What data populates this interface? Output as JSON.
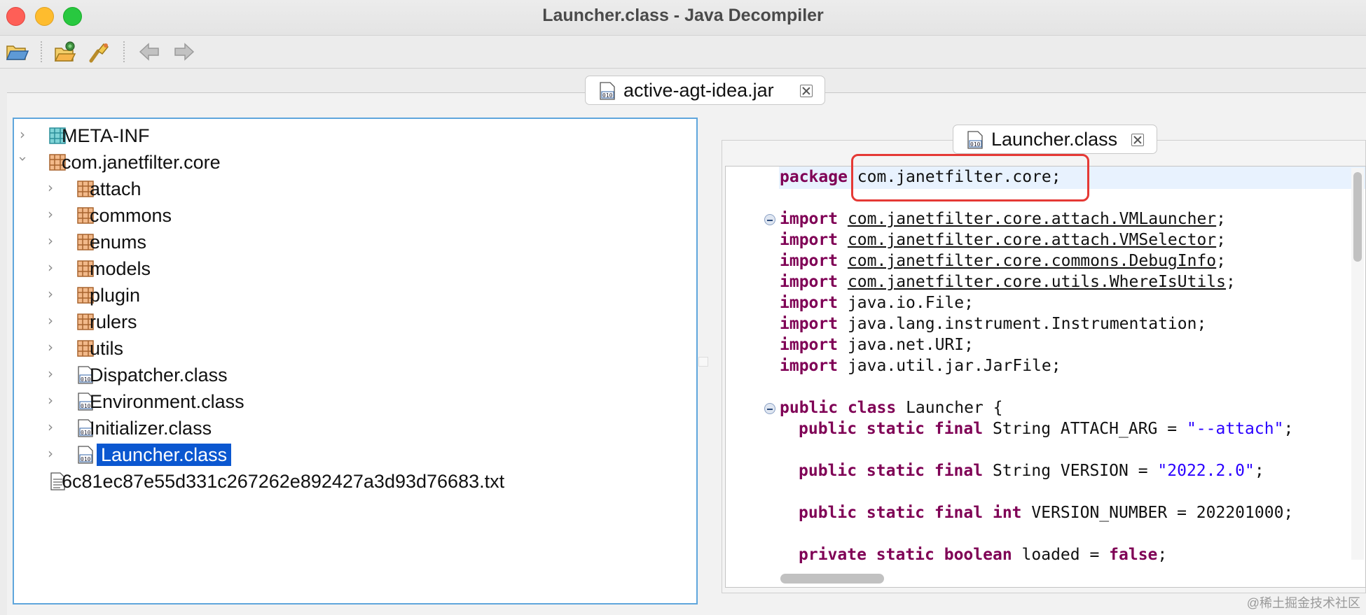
{
  "window": {
    "title": "Launcher.class - Java Decompiler",
    "controls": [
      "close",
      "minimize",
      "zoom"
    ]
  },
  "toolbar": {
    "buttons": [
      {
        "icon": "open-file-icon"
      },
      {
        "icon": "open-type-icon"
      },
      {
        "icon": "search-icon"
      },
      {
        "icon": "back-arrow-icon"
      },
      {
        "icon": "forward-arrow-icon"
      }
    ]
  },
  "jar_tab": {
    "label": "active-agt-idea.jar"
  },
  "tree": {
    "nodes": [
      {
        "label": "META-INF",
        "type": "folder",
        "expanded": false
      },
      {
        "label": "com.janetfilter.core",
        "type": "package",
        "expanded": true
      },
      {
        "label": "attach",
        "type": "package",
        "expanded": false
      },
      {
        "label": "commons",
        "type": "package",
        "expanded": false
      },
      {
        "label": "enums",
        "type": "package",
        "expanded": false
      },
      {
        "label": "models",
        "type": "package",
        "expanded": false
      },
      {
        "label": "plugin",
        "type": "package",
        "expanded": false
      },
      {
        "label": "rulers",
        "type": "package",
        "expanded": false
      },
      {
        "label": "utils",
        "type": "package",
        "expanded": false
      },
      {
        "label": "Dispatcher.class",
        "type": "class",
        "expanded": false
      },
      {
        "label": "Environment.class",
        "type": "class",
        "expanded": false
      },
      {
        "label": "Initializer.class",
        "type": "class",
        "expanded": false
      },
      {
        "label": "Launcher.class",
        "type": "class",
        "expanded": false,
        "selected": true
      },
      {
        "label": "6c81ec87e55d331c267262e892427a3d93d76683.txt",
        "type": "text"
      }
    ]
  },
  "editor_tab": {
    "label": "Launcher.class"
  },
  "code": {
    "package_kw": "package",
    "package_name": "com.janetfilter.core;",
    "import_kw": "import",
    "imports": [
      {
        "name": "com.janetfilter.core.attach.VMLauncher",
        "link": true
      },
      {
        "name": "com.janetfilter.core.attach.VMSelector",
        "link": true
      },
      {
        "name": "com.janetfilter.core.commons.DebugInfo",
        "link": true
      },
      {
        "name": "com.janetfilter.core.utils.WhereIsUtils",
        "link": true
      },
      {
        "name": "java.io.File",
        "link": false
      },
      {
        "name": "java.lang.instrument.Instrumentation",
        "link": false
      },
      {
        "name": "java.net.URI",
        "link": false
      },
      {
        "name": "java.util.jar.JarFile",
        "link": false
      }
    ],
    "semicolon": ";",
    "class_decl": {
      "kw1": "public",
      "kw2": "class",
      "name": "Launcher {"
    },
    "fields": [
      {
        "mods": "public static final",
        "type": "String",
        "name": "ATTACH_ARG =",
        "value": "\"--attach\"",
        "value_kind": "string"
      },
      {
        "mods": "public static final",
        "type": "String",
        "name": "VERSION =",
        "value": "\"2022.2.0\"",
        "value_kind": "string"
      },
      {
        "mods": "public static final",
        "type": "int",
        "name": "VERSION_NUMBER =",
        "value": "202201000",
        "value_kind": "plain"
      },
      {
        "mods": "private static",
        "type": "boolean",
        "name": "loaded =",
        "value": "false",
        "value_kind": "keyword"
      }
    ]
  },
  "colors": {
    "keyword": "#7f0055",
    "string": "#2a00ff",
    "selection": "#0b57d0",
    "highlight_box": "#e53935"
  },
  "watermark": "@稀土掘金技术社区"
}
